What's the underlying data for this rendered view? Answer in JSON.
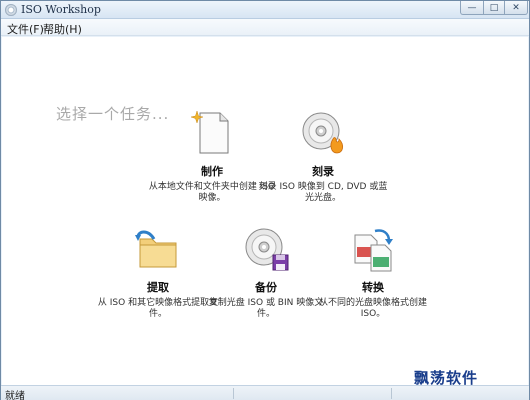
{
  "window": {
    "title": "ISO Workshop"
  },
  "menu": {
    "file": "文件(F)",
    "help": "帮助(H)"
  },
  "main": {
    "prompt": "选择一个任务...",
    "tasks": [
      {
        "title": "制作",
        "desc": "从本地文件和文件夹中创建 ISO 映像。",
        "icon": "document-new-icon"
      },
      {
        "title": "刻录",
        "desc": "刻录 ISO 映像到 CD, DVD 或蓝光光盘。",
        "icon": "disc-burn-icon"
      },
      {
        "title": "提取",
        "desc": "从 ISO 和其它映像格式提取文件。",
        "icon": "folder-extract-icon"
      },
      {
        "title": "备份",
        "desc": "复制光盘 ISO 或 BIN 映像文件。",
        "icon": "disc-backup-icon"
      },
      {
        "title": "转换",
        "desc": "从不同的光盘映像格式创建 ISO。",
        "icon": "convert-icon"
      }
    ]
  },
  "status": {
    "text": "就绪"
  },
  "watermark": "飘荡软件",
  "colors": {
    "accent": "#1a3e8c",
    "prompt": "#a9a9a9"
  }
}
